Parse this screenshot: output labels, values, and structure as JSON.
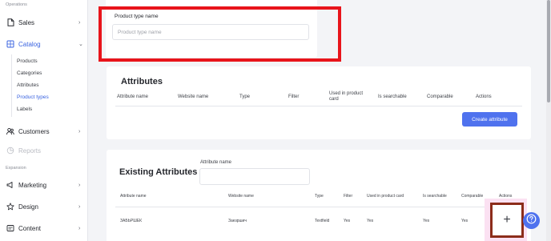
{
  "sidebar": {
    "section_operations": "Operations",
    "sales": "Sales",
    "catalog": "Catalog",
    "catalog_items": [
      "Products",
      "Categories",
      "Attributes",
      "Product types",
      "Labels"
    ],
    "customers": "Customers",
    "reports": "Reports",
    "section_expansion": "Expansion",
    "marketing": "Marketing",
    "design": "Design",
    "content": "Content"
  },
  "product_type": {
    "label": "Product type name",
    "placeholder": "Product type name"
  },
  "attributes_card": {
    "title": "Attributes",
    "headers": [
      "Attribute name",
      "Website name",
      "Type",
      "Filter",
      "Used in product card",
      "Is searchable",
      "Comparable",
      "Actions"
    ],
    "create_button": "Create attribute"
  },
  "existing_card": {
    "title": "Existing Attributes",
    "search_label": "Attribute name",
    "headers": [
      "Attribute name",
      "Website name",
      "Type",
      "Filter",
      "Used in product card",
      "Is searchable",
      "Comparable",
      "Actions"
    ],
    "rows": [
      {
        "attribute_name": "ЗАБЬРШЕК",
        "website_name": "Заезршич",
        "type": "Textfield",
        "filter": "Yes",
        "used_in_product_card": "Yes",
        "is_searchable": "Yes",
        "comparable": "Yes",
        "action": "+"
      }
    ]
  },
  "colors": {
    "accent": "#3a63e0",
    "button": "#4f72ee",
    "highlight_red": "#e8141b",
    "highlight_brown": "#8c2c1a",
    "highlight_pink": "#fbe1f2"
  },
  "icons": [
    "sales-doc-icon",
    "catalog-icon",
    "customers-icon",
    "reports-icon",
    "marketing-icon",
    "design-icon",
    "content-icon",
    "help-icon",
    "chevron-right-icon",
    "chevron-down-icon"
  ]
}
